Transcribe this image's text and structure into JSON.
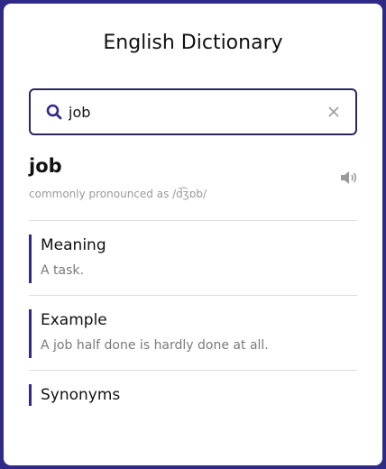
{
  "app": {
    "title": "English Dictionary"
  },
  "search": {
    "value": "job",
    "placeholder": ""
  },
  "result": {
    "word": "job",
    "phonetic": "commonly pronounced as /d͡ʒɒb/"
  },
  "sections": {
    "meaning": {
      "title": "Meaning",
      "text": "A task."
    },
    "example": {
      "title": "Example",
      "text": "A job half done is hardly done at all."
    },
    "synonyms": {
      "title": "Synonyms"
    }
  },
  "icons": {
    "search": "search-icon",
    "clear": "close-icon",
    "speaker": "speaker-icon"
  },
  "colors": {
    "background": "#2e2a86",
    "accent": "#2e2a86",
    "card": "#ffffff"
  }
}
